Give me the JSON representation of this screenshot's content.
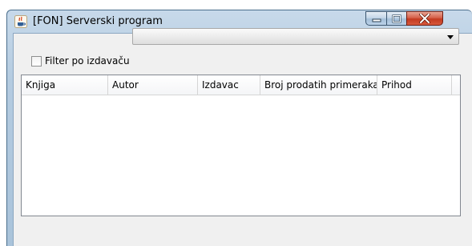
{
  "window": {
    "title": "[FON] Serverski program",
    "app_icon": "java-coffee-cup-icon",
    "controls": {
      "minimize_icon": "minimize-icon",
      "maximize_icon": "maximize-icon",
      "close_icon": "close-icon"
    }
  },
  "filter": {
    "checkbox_label": "Filter po izdavaču",
    "checked": false,
    "publisher_selected": "",
    "dropdown_icon": "chevron-down-icon"
  },
  "table": {
    "columns": [
      "Knjiga",
      "Autor",
      "Izdavac",
      "Broj prodatih primeraka",
      "Prihod"
    ],
    "rows": []
  },
  "colors": {
    "title_bar": "#b4cbe0",
    "content_bg": "#f0f0f0",
    "close_button": "#c33a20"
  }
}
